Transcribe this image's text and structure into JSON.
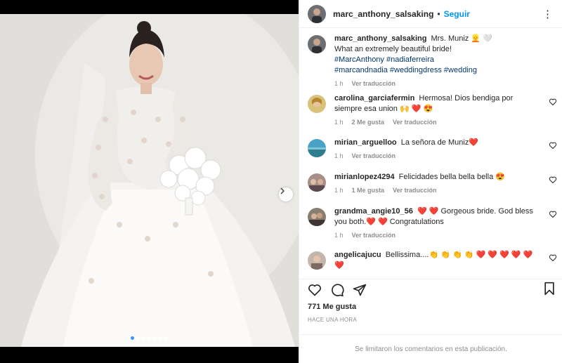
{
  "post": {
    "author": "marc_anthony_salsaking",
    "separator": "•",
    "follow_label": "Seguir",
    "more_label": "⋮",
    "image_alt": "Bride in a white embroidered wedding dress holding white bouquet",
    "carousel": {
      "count": 7,
      "active": 1
    }
  },
  "caption": {
    "author": "marc_anthony_salsaking",
    "line1": "Mrs. Muniz 👱 🤍",
    "line2": "What an extremely beautiful bride!",
    "hashtags1": "#MarcAnthony #nadiaferreira",
    "hashtags2": "#marcandnadia #weddingdress #wedding",
    "time": "1 h",
    "translate": "Ver traducción"
  },
  "comments": [
    {
      "user": "carolina_garciafermin",
      "text": "Hermosa! Dios bendiga por siempre esa union 🙌 ❤️ 😍",
      "time": "1 h",
      "likes": "2 Me gusta",
      "translate": "Ver traducción"
    },
    {
      "user": "mirian_arguelloo",
      "text": "La señora de Muniz❤️",
      "time": "1 h",
      "likes": "",
      "translate": "Ver traducción"
    },
    {
      "user": "mirianlopez4294",
      "text": "Felicidades bella bella bella 😍",
      "time": "1 h",
      "likes": "1 Me gusta",
      "translate": "Ver traducción"
    },
    {
      "user": "grandma_angie10_56",
      "text": "❤️ ❤️ Gorgeous bride. God bless you both.❤️ ❤️ Congratulations",
      "time": "1 h",
      "likes": "",
      "translate": "Ver traducción"
    },
    {
      "user": "angelicajucu",
      "text": "Bellissima....👏 👏 👏 👏 ❤️ ❤️ ❤️ ❤️ ❤️ ❤️",
      "time": "",
      "likes": "",
      "translate": ""
    }
  ],
  "likes_count": "771 Me gusta",
  "time_ago": "HACE UNA HORA",
  "comments_disabled": "Se limitaron los comentarios en esta publicación.",
  "colors": {
    "accent": "#0095f6",
    "text": "#262626",
    "muted": "#8e8e8e",
    "hashtag": "#00376b"
  }
}
